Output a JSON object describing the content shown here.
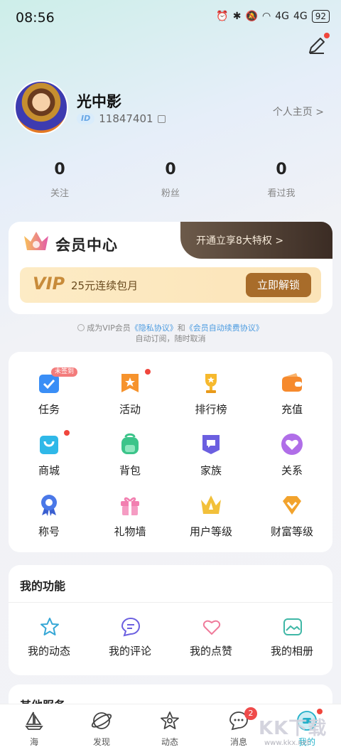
{
  "status_bar": {
    "time": "08:56",
    "battery": "92",
    "signal_1": "4G",
    "signal_2": "4G"
  },
  "profile": {
    "username": "光中影",
    "id_tag": "ID",
    "id_number": "11847401",
    "homepage_link": "个人主页 >"
  },
  "stats": [
    {
      "value": "0",
      "label": "关注"
    },
    {
      "value": "0",
      "label": "粉丝"
    },
    {
      "value": "0",
      "label": "看过我"
    }
  ],
  "vip": {
    "title": "会员中心",
    "banner": "开通立享8大特权 >",
    "logo": "VIP",
    "description": "25元连续包月",
    "unlock_button": "立即解锁"
  },
  "agreement": {
    "prefix": "成为VIP会员",
    "privacy_link": "《隐私协议》",
    "and": "和",
    "auto_renew_link": "《会员自动续费协议》",
    "line2": "自动订阅，随时取消"
  },
  "grid": {
    "unsigned_tag": "未签到",
    "items": [
      {
        "label": "任务",
        "icon": "task-check-icon",
        "color": "#3a8ef6"
      },
      {
        "label": "活动",
        "icon": "star-flag-icon",
        "color": "#f6932d"
      },
      {
        "label": "排行榜",
        "icon": "trophy-icon",
        "color": "#f6b92d"
      },
      {
        "label": "充值",
        "icon": "wallet-icon",
        "color": "#f68a2d"
      },
      {
        "label": "商城",
        "icon": "shopping-bag-icon",
        "color": "#2fb8e8"
      },
      {
        "label": "背包",
        "icon": "backpack-icon",
        "color": "#3cc48a"
      },
      {
        "label": "家族",
        "icon": "family-flag-icon",
        "color": "#6b5fe0"
      },
      {
        "label": "关系",
        "icon": "heart-icon",
        "color": "#b06ee8"
      },
      {
        "label": "称号",
        "icon": "medal-icon",
        "color": "#4a78e8"
      },
      {
        "label": "礼物墙",
        "icon": "gift-icon",
        "color": "#f27fb0"
      },
      {
        "label": "用户等级",
        "icon": "crown-icon",
        "color": "#f2c03a"
      },
      {
        "label": "财富等级",
        "icon": "diamond-icon",
        "color": "#f2a32d"
      }
    ]
  },
  "my_functions": {
    "title": "我的功能",
    "items": [
      {
        "label": "我的动态",
        "icon": "star-outline-icon"
      },
      {
        "label": "我的评论",
        "icon": "comment-icon"
      },
      {
        "label": "我的点赞",
        "icon": "heart-outline-icon"
      },
      {
        "label": "我的相册",
        "icon": "photo-album-icon"
      }
    ]
  },
  "other_services": {
    "title": "其他服务"
  },
  "tabbar": {
    "items": [
      {
        "label": "海",
        "icon": "sailboat-icon"
      },
      {
        "label": "发现",
        "icon": "planet-icon"
      },
      {
        "label": "动态",
        "icon": "star-outline-icon"
      },
      {
        "label": "消息",
        "icon": "message-icon",
        "badge": "2"
      },
      {
        "label": "我的",
        "icon": "profile-icon"
      }
    ]
  },
  "watermark": {
    "text": "KK下载",
    "url": "www.kkx.net"
  },
  "colors": {
    "accent": "#22b0c9",
    "vip_gold": "#a86c2a",
    "badge_red": "#ef4a4a"
  }
}
